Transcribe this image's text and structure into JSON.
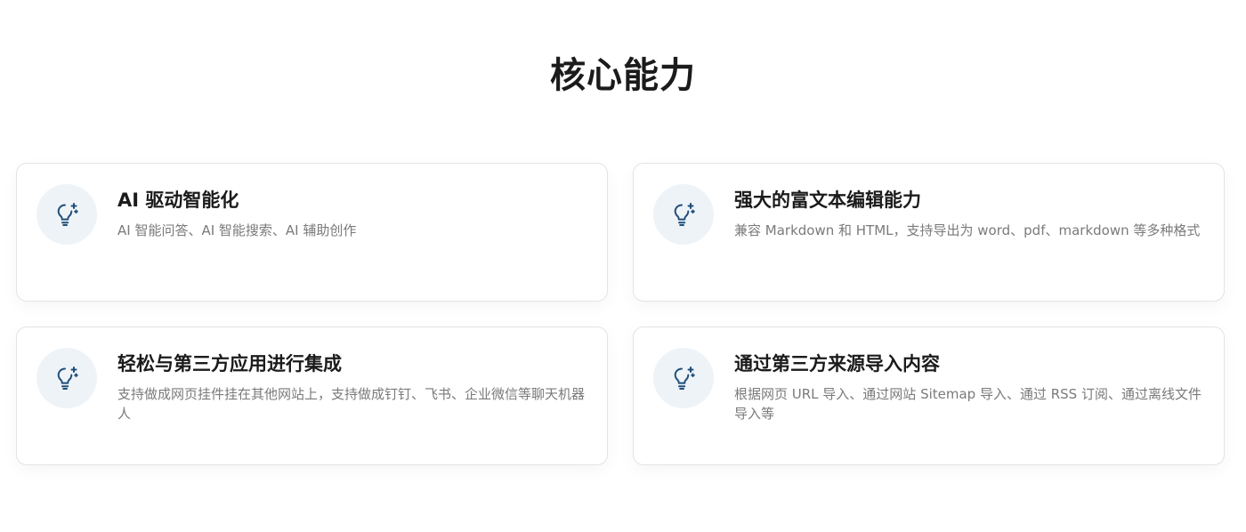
{
  "section": {
    "title": "核心能力"
  },
  "features": [
    {
      "icon": "lightbulb-sparkle-icon",
      "title": "AI 驱动智能化",
      "description": "AI 智能问答、AI 智能搜索、AI 辅助创作"
    },
    {
      "icon": "lightbulb-sparkle-icon",
      "title": "强大的富文本编辑能力",
      "description": "兼容 Markdown 和 HTML，支持导出为 word、pdf、markdown 等多种格式"
    },
    {
      "icon": "lightbulb-sparkle-icon",
      "title": "轻松与第三方应用进行集成",
      "description": "支持做成网页挂件挂在其他网站上，支持做成钉钉、飞书、企业微信等聊天机器人"
    },
    {
      "icon": "lightbulb-sparkle-icon",
      "title": "通过第三方来源导入内容",
      "description": "根据网页 URL 导入、通过网站 Sitemap 导入、通过 RSS 订阅、通过离线文件导入等"
    }
  ],
  "colors": {
    "icon_stroke": "#1f4e79",
    "icon_bg": "#eef3f8",
    "title": "#1b1b1b",
    "description": "#7a7a7a",
    "card_border": "#e3e3e3"
  }
}
